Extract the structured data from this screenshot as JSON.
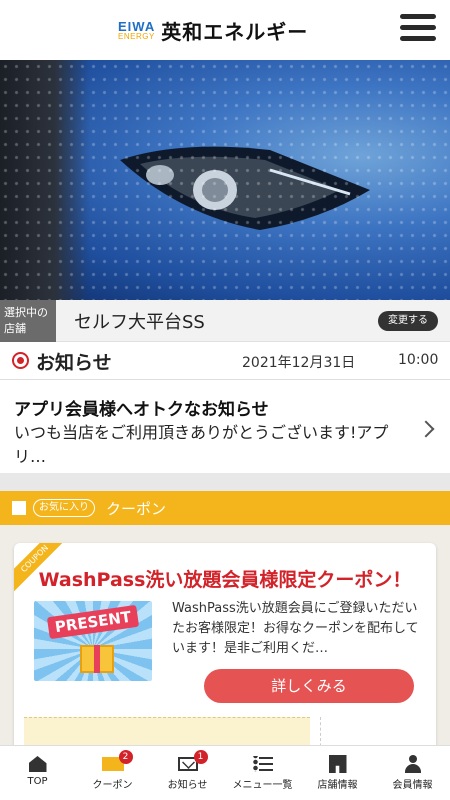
{
  "header": {
    "logo_top": "EIWA",
    "logo_bottom": "ENERGY",
    "brand_name": "英和エネルギー",
    "menu_icon": "hamburger-menu-icon"
  },
  "store": {
    "tag_label": "選択中の店舗",
    "name": "セルフ大平台SS",
    "change_label": "変更する"
  },
  "news": {
    "title": "お知らせ",
    "date": "2021年12月31日",
    "time": "10:00",
    "item_title": "アプリ会員様へオトクなお知らせ",
    "item_body": "いつも当店をご利用頂きありがとうございます!アプリ…"
  },
  "coupon_section": {
    "favorite_label": "お気に入り",
    "title": "クーポン",
    "ribbon": "COUPON",
    "card_title": "WashPass洗い放題会員様限定クーポン！",
    "image_text": "PRESENT",
    "description": "WashPass洗い放題会員にご登録いただいたお客様限定！お得なクーポンを配布しています！是非ご利用くだ…",
    "detail_button": "詳しくみる"
  },
  "bottom_nav": {
    "items": [
      {
        "label": "TOP",
        "icon": "home-icon"
      },
      {
        "label": "クーポン",
        "icon": "coupon-icon",
        "badge": "2"
      },
      {
        "label": "お知らせ",
        "icon": "mail-icon",
        "badge": "1"
      },
      {
        "label": "メニュー一覧",
        "icon": "list-icon"
      },
      {
        "label": "店舗情報",
        "icon": "store-icon"
      },
      {
        "label": "会員情報",
        "icon": "user-icon"
      }
    ]
  },
  "colors": {
    "accent_yellow": "#f4b51c",
    "accent_red": "#d2232a",
    "button_red": "#e55353",
    "brand_blue": "#1f6fc5"
  }
}
